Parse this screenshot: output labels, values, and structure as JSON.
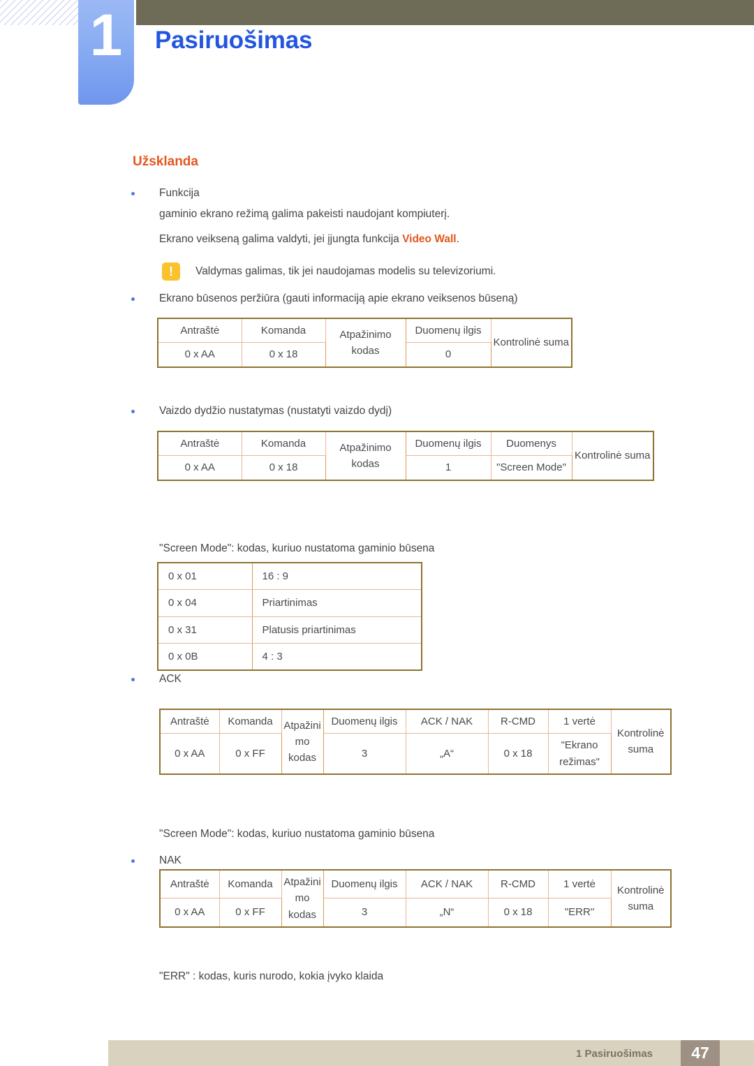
{
  "header": {
    "chapter_number": "1",
    "chapter_title": "Pasiruošimas",
    "band_color": "#6e6c56",
    "tab_color": "#8db0f2",
    "title_color": "#2356e0"
  },
  "section": {
    "heading": "Užsklanda",
    "heading_color": "#e2581e"
  },
  "bullets": {
    "funkcija": "Funkcija",
    "ack": "ACK",
    "nak": "NAK",
    "status_view": "Ekrano būsenos peržiūra (gauti informaciją apie ekrano veiksenos būseną)",
    "size_set": "Vaizdo dydžio nustatymas (nustatyti vaizdo dydį)"
  },
  "paragraphs": {
    "line1": "gaminio ekrano režimą galima pakeisti naudojant kompiuterį.",
    "line2_prefix": "Ekrano veikseną galima valdyti, jei įjungta funkcija ",
    "line2_accent": "Video Wall",
    "line2_suffix": ".",
    "screen_mode_note_1": "\"Screen Mode\": kodas, kuriuo nustatoma gaminio būsena",
    "screen_mode_note_2": "\"Screen Mode\": kodas, kuriuo nustatoma gaminio būsena",
    "err_note": "\"ERR\" : kodas, kuris nurodo, kokia įvyko klaida"
  },
  "note": {
    "icon": "exclamation-icon",
    "icon_glyph": "!",
    "icon_color": "#fcc22d",
    "text": "Valdymas galimas, tik jei naudojamas modelis su televizoriumi."
  },
  "table_status": {
    "headers": [
      "Antraštė",
      "Komanda",
      "Atpažinimo kodas",
      "Duomenų ilgis",
      "Kontrolinė suma"
    ],
    "values": [
      "0 x AA",
      "0 x 18",
      "0"
    ]
  },
  "table_size": {
    "headers": [
      "Antraštė",
      "Komanda",
      "Atpažinimo kodas",
      "Duomenų ilgis",
      "Duomenys",
      "Kontrolinė suma"
    ],
    "values": [
      "0 x AA",
      "0 x 18",
      "1",
      "\"Screen Mode\""
    ]
  },
  "table_codes": {
    "rows": [
      {
        "code": "0 x 01",
        "desc": "16 : 9"
      },
      {
        "code": "0 x 04",
        "desc": "Priartinimas"
      },
      {
        "code": "0 x 31",
        "desc": "Platusis priartinimas"
      },
      {
        "code": "0 x 0B",
        "desc": "4 : 3"
      }
    ]
  },
  "table_ack": {
    "headers": [
      "Antraštė",
      "Komanda",
      "Atpažinimo kodas",
      "Duomenų ilgis",
      "ACK / NAK",
      "R-CMD",
      "1 vertė",
      "Kontrolinė suma"
    ],
    "values": [
      "0 x AA",
      "0 x FF",
      "3",
      "„A“",
      "0 x 18",
      "\"Ekrano režimas\""
    ]
  },
  "table_nak": {
    "headers": [
      "Antraštė",
      "Komanda",
      "Atpažinimo kodas",
      "Duomenų ilgis",
      "ACK / NAK",
      "R-CMD",
      "1 vertė",
      "Kontrolinė suma"
    ],
    "values": [
      "0 x AA",
      "0 x FF",
      "3",
      "„N“",
      "0 x 18",
      "\"ERR\""
    ]
  },
  "footer": {
    "text": "1 Pasiruošimas",
    "page": "47",
    "band_color": "#d9d2bf",
    "page_box_color": "#9e9184"
  }
}
